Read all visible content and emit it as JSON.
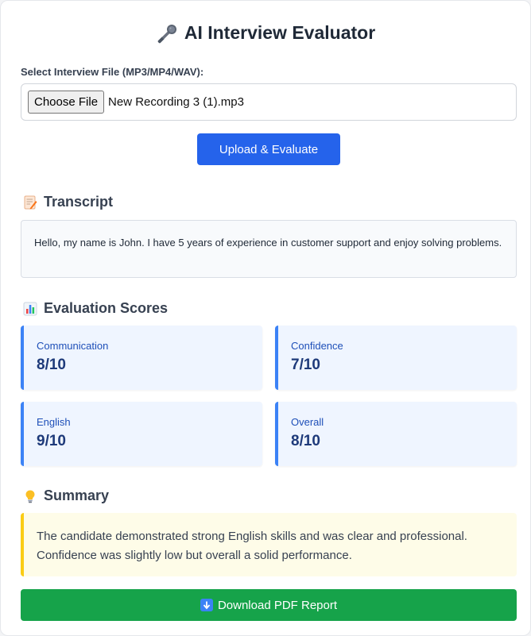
{
  "app": {
    "title": "AI Interview Evaluator"
  },
  "upload": {
    "label": "Select Interview File (MP3/MP4/WAV):",
    "choose_button": "Choose File",
    "file_name": "New Recording 3 (1).mp3",
    "submit_button": "Upload & Evaluate"
  },
  "transcript": {
    "heading": "Transcript",
    "text": "Hello, my name is John. I have 5 years of experience in customer support and enjoy solving problems."
  },
  "scores": {
    "heading": "Evaluation Scores",
    "items": [
      {
        "label": "Communication",
        "value": "8/10"
      },
      {
        "label": "Confidence",
        "value": "7/10"
      },
      {
        "label": "English",
        "value": "9/10"
      },
      {
        "label": "Overall",
        "value": "8/10"
      }
    ]
  },
  "summary": {
    "heading": "Summary",
    "text": "The candidate demonstrated strong English skills and was clear and professional. Confidence was slightly low but overall a solid performance."
  },
  "actions": {
    "download_button": "Download PDF Report"
  },
  "icons": {
    "title": "microphone-icon",
    "transcript": "memo-icon",
    "scores": "bar-chart-icon",
    "summary": "light-bulb-icon",
    "download": "down-arrow-icon"
  },
  "colors": {
    "primary": "#2563eb",
    "success": "#16a34a",
    "score_accent": "#3b82f6",
    "summary_accent": "#facc15"
  }
}
